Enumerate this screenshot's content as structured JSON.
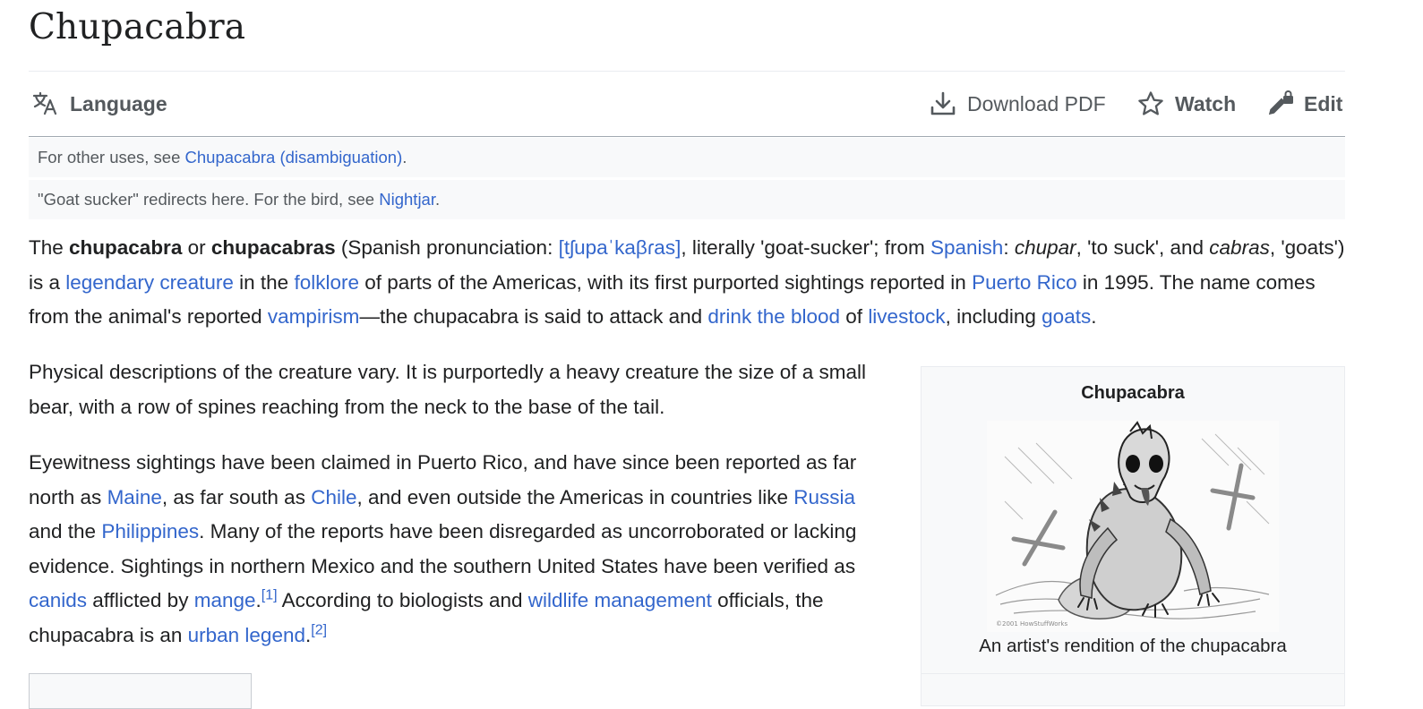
{
  "article": {
    "title": "Chupacabra"
  },
  "toolbar": {
    "language_label": "Language",
    "download_label": "Download PDF",
    "watch_label": "Watch",
    "edit_label": "Edit"
  },
  "hatnotes": [
    {
      "prefix": "For other uses, see ",
      "link": "Chupacabra (disambiguation)",
      "suffix": "."
    },
    {
      "prefix": "\"Goat sucker\" redirects here. For the bird, see ",
      "link": "Nightjar",
      "suffix": "."
    }
  ],
  "paragraphs": {
    "p1": {
      "t1": "The ",
      "b1": "chupacabra",
      "t2": " or ",
      "b2": "chupacabras",
      "t3": " (Spanish pronunciation: ",
      "ipa": "[tʃupaˈkaβɾas]",
      "t4": ", literally 'goat-sucker'; from ",
      "l_spanish": "Spanish",
      "t5": ": ",
      "i1": "chupar",
      "t6": ", 'to suck', and ",
      "i2": "cabras",
      "t7": ", 'goats') is a ",
      "l_legendary": "legendary creature",
      "t8": " in the ",
      "l_folklore": "folklore",
      "t9": " of parts of the Americas, with its first purported sightings reported in ",
      "l_pr": "Puerto Rico",
      "t10": " in 1995. The name comes from the animal's reported ",
      "l_vamp": "vampirism",
      "t11": "—the chupacabra is said to attack and ",
      "l_blood": "drink the blood",
      "t12": " of ",
      "l_livestock": "livestock",
      "t13": ", including ",
      "l_goats": "goats",
      "t14": "."
    },
    "p2": "Physical descriptions of the creature vary. It is purportedly a heavy creature the size of a small bear, with a row of spines reaching from the neck to the base of the tail.",
    "p3": {
      "t1": "Eyewitness sightings have been claimed in Puerto Rico, and have since been reported as far north as ",
      "l_maine": "Maine",
      "t2": ", as far south as ",
      "l_chile": "Chile",
      "t3": ", and even outside the Americas in countries like ",
      "l_russia": "Russia",
      "t4": " and the ",
      "l_phil": "Philippines",
      "t5": ". Many of the reports have been disregarded as uncorroborated or lacking evidence. Sightings in northern Mexico and the southern United States have been verified as ",
      "l_canids": "canids",
      "t6": " afflicted by ",
      "l_mange": "mange",
      "t7": ".",
      "ref1": "[1]",
      "t8": " According to biologists and ",
      "l_wildlife": "wildlife management",
      "t9": " officials, the chupacabra is an ",
      "l_urban": "urban legend",
      "t10": ".",
      "ref2": "[2]"
    }
  },
  "infobox": {
    "title": "Chupacabra",
    "image_watermark": "©2001 HowStuffWorks",
    "caption": "An artist's rendition of the chupacabra"
  }
}
